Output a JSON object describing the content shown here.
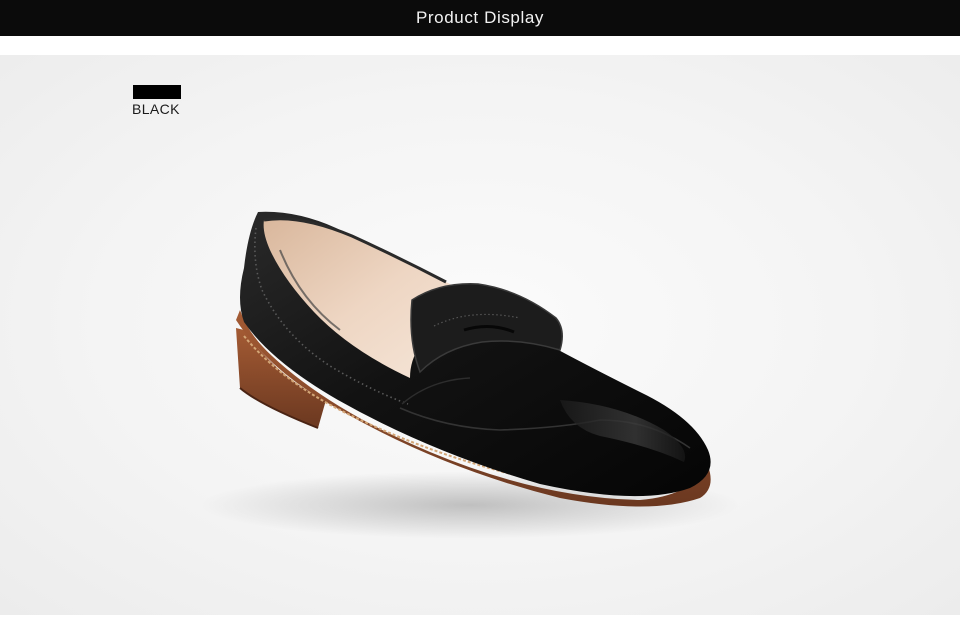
{
  "header": {
    "title": "Product Display"
  },
  "swatch": {
    "label": "BLACK",
    "color": "#000000"
  },
  "colors": {
    "header_bg": "#0b0b0b",
    "header_text": "#f2f2f2",
    "photo_bg": "#f4f4f4",
    "leather": "#141414",
    "lining": "#e6c9b2",
    "sole": "#8a4a2c",
    "welt_stitch": "#c99a6a"
  },
  "image": {
    "subject_icon": "penny-loafer-icon"
  }
}
